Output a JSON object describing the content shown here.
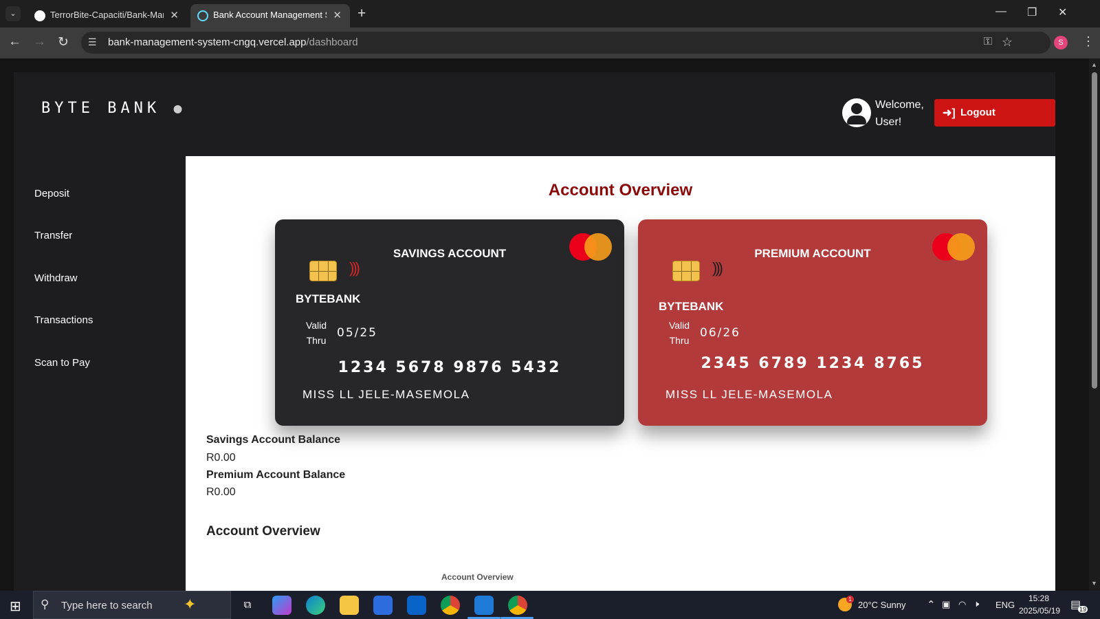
{
  "browser": {
    "tabs": [
      {
        "title": "TerrorBite-Capaciti/Bank-Mana",
        "active": false
      },
      {
        "title": "Bank Account Management Sys",
        "active": true
      }
    ],
    "new_tab": "+",
    "url_host": "bank-management-system-cngq.vercel.app",
    "url_path": "/dashboard",
    "profile_initial": "S",
    "window_controls": {
      "minimize": "—",
      "restore": "❐",
      "close": "✕"
    }
  },
  "app": {
    "logo_text": "BYTE BANK",
    "welcome": "Welcome, User!",
    "logout_label": "Logout",
    "sidebar": [
      {
        "label": "Deposit"
      },
      {
        "label": "Transfer"
      },
      {
        "label": "Withdraw"
      },
      {
        "label": "Transactions"
      },
      {
        "label": "Scan to Pay"
      }
    ],
    "main": {
      "title": "Account Overview",
      "cards": [
        {
          "type": "SAVINGS ACCOUNT",
          "brand": "BYTEBANK",
          "valid_label": "Valid Thru",
          "valid_date": "05/25",
          "number": "1234 5678 9876 5432",
          "holder": "MISS LL JELE-MASEMOLA",
          "color": "#27272a"
        },
        {
          "type": "PREMIUM ACCOUNT",
          "brand": "BYTEBANK",
          "valid_label": "Valid Thru",
          "valid_date": "06/26",
          "number": "2345 6789 1234 8765",
          "holder": "MISS LL JELE-MASEMOLA",
          "color": "#b23a3a"
        }
      ],
      "balances": [
        {
          "label": "Savings Account Balance",
          "value": "R0.00"
        },
        {
          "label": "Premium Account Balance",
          "value": "R0.00"
        }
      ],
      "section_title": "Account Overview",
      "chart_title": "Account Overview"
    },
    "colors": {
      "accent": "#cc1414",
      "title_red": "#8b0a0a"
    }
  },
  "taskbar": {
    "search_placeholder": "Type here to search",
    "weather": "20°C  Sunny",
    "weather_badge": "1",
    "language": "ENG",
    "time": "15:28",
    "date": "2025/05/19",
    "notification_count": "19"
  }
}
